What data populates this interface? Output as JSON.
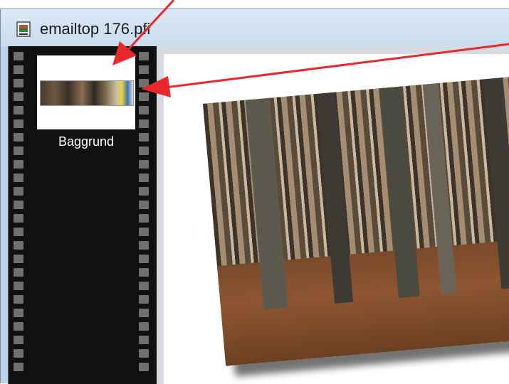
{
  "window": {
    "title": "emailtop 176.pfi"
  },
  "filmstrip": {
    "items": [
      {
        "label": "Baggrund",
        "selected": true
      }
    ]
  },
  "colors": {
    "titlebar": "#c9dbee",
    "filmstrip": "#111111",
    "arrow": "#e8282b"
  },
  "icons": {
    "document": "film-document-icon"
  }
}
